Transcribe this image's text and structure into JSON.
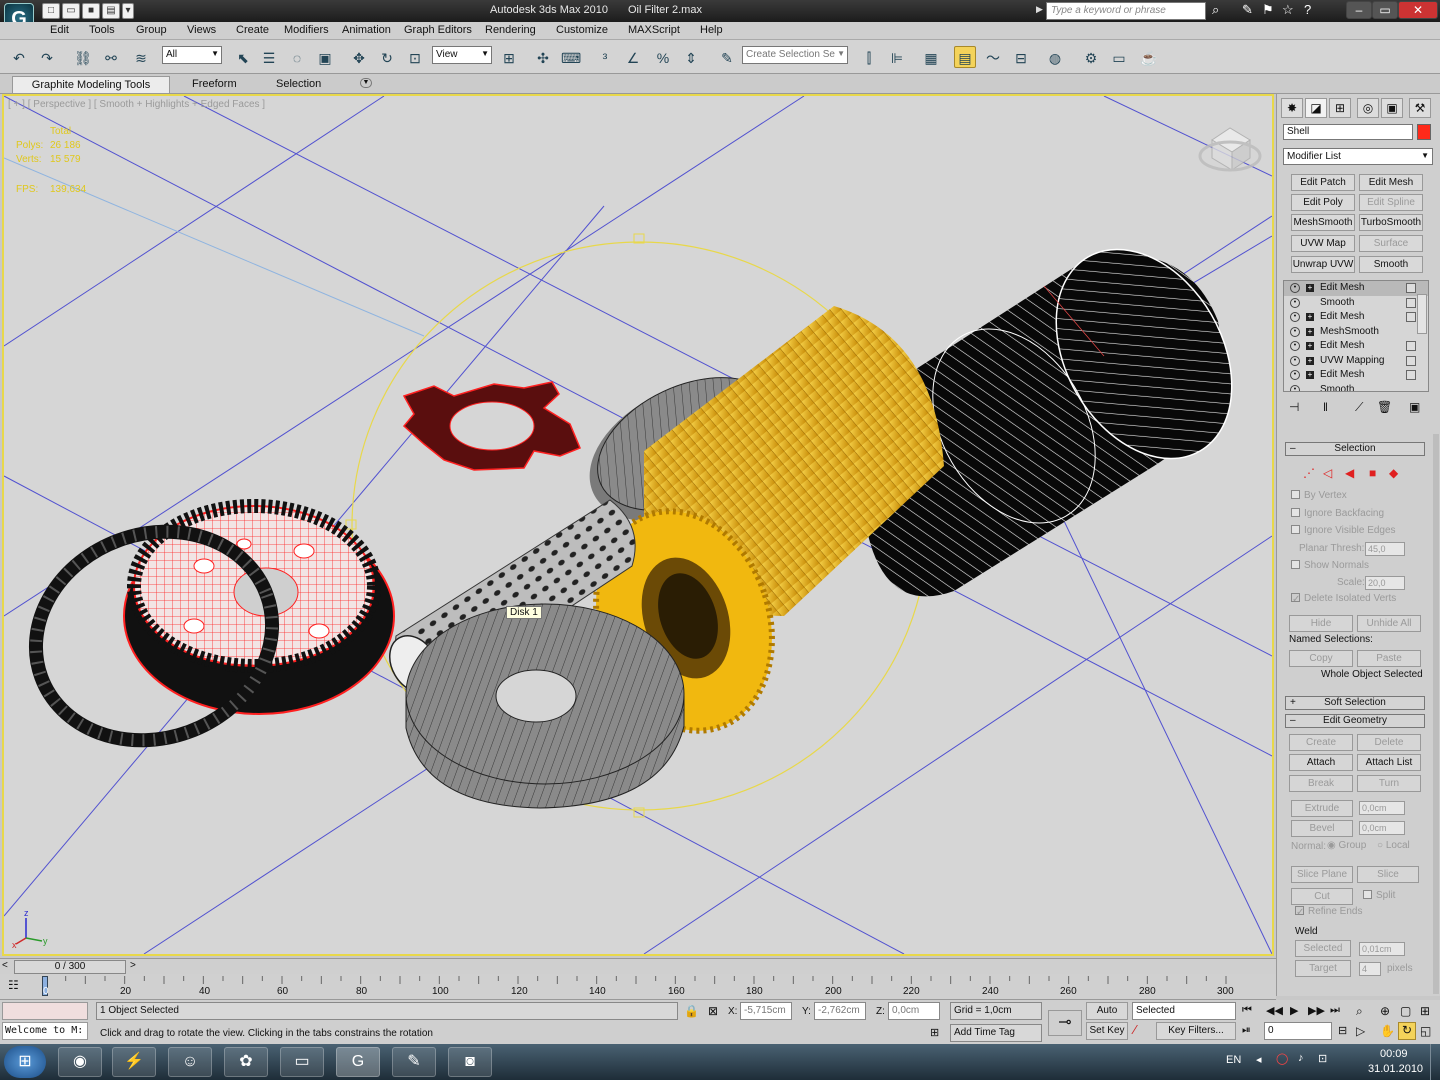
{
  "titlebar": {
    "app_title": "Autodesk 3ds Max 2010",
    "file_title": "Oil Filter 2.max",
    "search_placeholder": "Type a keyword or phrase"
  },
  "menu": [
    "Edit",
    "Tools",
    "Group",
    "Views",
    "Create",
    "Modifiers",
    "Animation",
    "Graph Editors",
    "Rendering",
    "Customize",
    "MAXScript",
    "Help"
  ],
  "toolbar": {
    "selection_filter": "All",
    "ref_coord": "View",
    "named_selection_placeholder": "Create Selection Se"
  },
  "ribbon": {
    "tabs": [
      "Graphite Modeling Tools",
      "Freeform",
      "Selection"
    ]
  },
  "viewport": {
    "label": "[ + ] [ Perspective ] [ Smooth + Highlights + Edged Faces ]",
    "stats": {
      "header": "Total",
      "polys_label": "Polys:",
      "polys": "26 186",
      "verts_label": "Verts:",
      "verts": "15 579",
      "fps_label": "FPS:",
      "fps": "139,634"
    },
    "tooltip": "Disk 1",
    "axis": {
      "z": "z",
      "x": "x",
      "y": "y"
    }
  },
  "colors": {
    "selected_wire": "#ff2020",
    "gold": "#e8b410",
    "viewport_bg": "#d6d6d6",
    "grid": "#3b3bcf",
    "highlight": "#e8d84a"
  },
  "cmdpanel": {
    "tabs": [
      "create-icon",
      "modify-icon",
      "hierarchy-icon",
      "motion-icon",
      "display-icon",
      "utilities-icon"
    ],
    "object_name": "Shell",
    "modifier_list": "Modifier List",
    "modifier_buttons": [
      {
        "label": "Edit Patch",
        "enabled": true
      },
      {
        "label": "Edit Mesh",
        "enabled": true
      },
      {
        "label": "Edit Poly",
        "enabled": true
      },
      {
        "label": "Edit Spline",
        "enabled": false
      },
      {
        "label": "MeshSmooth",
        "enabled": true
      },
      {
        "label": "TurboSmooth",
        "enabled": true
      },
      {
        "label": "UVW Map",
        "enabled": true
      },
      {
        "label": "Surface",
        "enabled": false
      },
      {
        "label": "Unwrap UVW",
        "enabled": true
      },
      {
        "label": "Smooth",
        "enabled": true
      }
    ],
    "stack": [
      "Edit Mesh",
      "Smooth",
      "Edit Mesh",
      "MeshSmooth",
      "Edit Mesh",
      "UVW Mapping",
      "Edit Mesh",
      "Smooth"
    ],
    "selection": {
      "title": "Selection",
      "by_vertex": "By Vertex",
      "ignore_backfacing": "Ignore Backfacing",
      "ignore_visible_edges": "Ignore Visible Edges",
      "planar_thresh_label": "Planar Thresh:",
      "planar_thresh": "45,0",
      "show_normals": "Show Normals",
      "scale_label": "Scale:",
      "scale": "20,0",
      "delete_isolated": "Delete Isolated Verts",
      "hide": "Hide",
      "unhide_all": "Unhide All",
      "named_selections": "Named Selections:",
      "copy": "Copy",
      "paste": "Paste",
      "status": "Whole Object Selected"
    },
    "soft_selection": "Soft Selection",
    "edit_geometry": {
      "title": "Edit Geometry",
      "create": "Create",
      "delete": "Delete",
      "attach": "Attach",
      "attach_list": "Attach List",
      "break": "Break",
      "turn": "Turn",
      "extrude": "Extrude",
      "extrude_val": "0,0cm",
      "bevel": "Bevel",
      "bevel_val": "0,0cm",
      "normal": "Normal:",
      "group": "Group",
      "local": "Local",
      "slice_plane": "Slice Plane",
      "slice": "Slice",
      "cut": "Cut",
      "split": "Split",
      "refine_ends": "Refine Ends",
      "weld": "Weld",
      "selected": "Selected",
      "selected_val": "0,01cm",
      "target": "Target",
      "target_val": "4",
      "pixels": "pixels"
    }
  },
  "timeline": {
    "frame": "0 / 300",
    "ticks": [
      "0",
      "20",
      "40",
      "60",
      "80",
      "100",
      "120",
      "140",
      "160",
      "180",
      "200",
      "220",
      "240",
      "260",
      "280",
      "300"
    ]
  },
  "status": {
    "objects_selected": "1 Object Selected",
    "prompt": "Click and drag to rotate the view.  Clicking in the tabs constrains the rotation",
    "listener": "Welcome to M:",
    "x_label": "X:",
    "x": "-5,715cm",
    "y_label": "Y:",
    "y": "-2,762cm",
    "z_label": "Z:",
    "z": "0,0cm",
    "grid": "Grid = 1,0cm",
    "add_time_tag": "Add Time Tag",
    "auto_key": "Auto Key",
    "set_key": "Set Key",
    "key_mode": "Selected",
    "key_filters": "Key Filters...",
    "frame_field": "0"
  },
  "taskbar": {
    "lang": "EN",
    "time": "00:09",
    "date": "31.01.2010"
  }
}
